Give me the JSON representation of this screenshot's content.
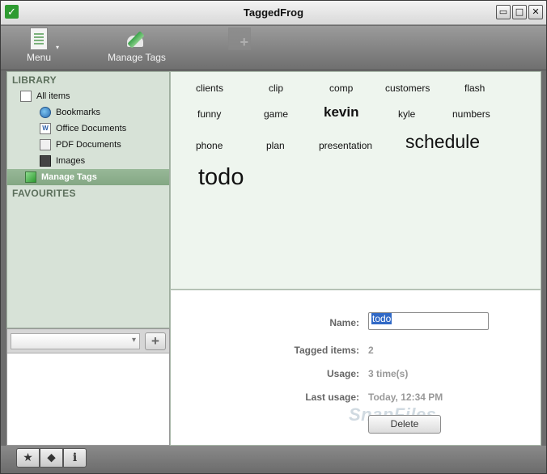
{
  "window": {
    "title": "TaggedFrog"
  },
  "window_controls": {
    "minimize": "▭",
    "maximize": "□",
    "close": "✕"
  },
  "toolbar": {
    "menu_label": "Menu",
    "manage_tags_label": "Manage Tags"
  },
  "sidebar": {
    "library_title": "LIBRARY",
    "favourites_title": "FAVOURITES",
    "items": [
      {
        "label": "All items",
        "icon": "list-icon"
      },
      {
        "label": "Bookmarks",
        "icon": "globe-icon"
      },
      {
        "label": "Office Documents",
        "icon": "word-document-icon"
      },
      {
        "label": "PDF Documents",
        "icon": "pdf-document-icon"
      },
      {
        "label": "Images",
        "icon": "film-image-icon"
      },
      {
        "label": "Manage Tags",
        "icon": "pen-icon",
        "selected": true
      }
    ]
  },
  "tags": [
    {
      "label": "clients",
      "size": "normal"
    },
    {
      "label": "clip",
      "size": "normal"
    },
    {
      "label": "comp",
      "size": "normal"
    },
    {
      "label": "customers",
      "size": "normal"
    },
    {
      "label": "flash",
      "size": "normal"
    },
    {
      "label": "funny",
      "size": "normal"
    },
    {
      "label": "game",
      "size": "normal"
    },
    {
      "label": "kevin",
      "size": "medium"
    },
    {
      "label": "kyle",
      "size": "normal"
    },
    {
      "label": "numbers",
      "size": "normal"
    },
    {
      "label": "phone",
      "size": "normal"
    },
    {
      "label": "plan",
      "size": "normal"
    },
    {
      "label": "presentation",
      "size": "normal"
    },
    {
      "label": "schedule",
      "size": "large"
    },
    {
      "label": "todo",
      "size": "xlarge"
    }
  ],
  "details": {
    "name_label": "Name:",
    "name_value": "todo",
    "tagged_items_label": "Tagged items:",
    "tagged_items_value": "2",
    "usage_label": "Usage:",
    "usage_value": "3 time(s)",
    "last_usage_label": "Last usage:",
    "last_usage_value": "Today, 12:34 PM",
    "delete_label": "Delete"
  },
  "watermark": "SnapFiles",
  "bottom_tabs": {
    "info_label": "i"
  }
}
